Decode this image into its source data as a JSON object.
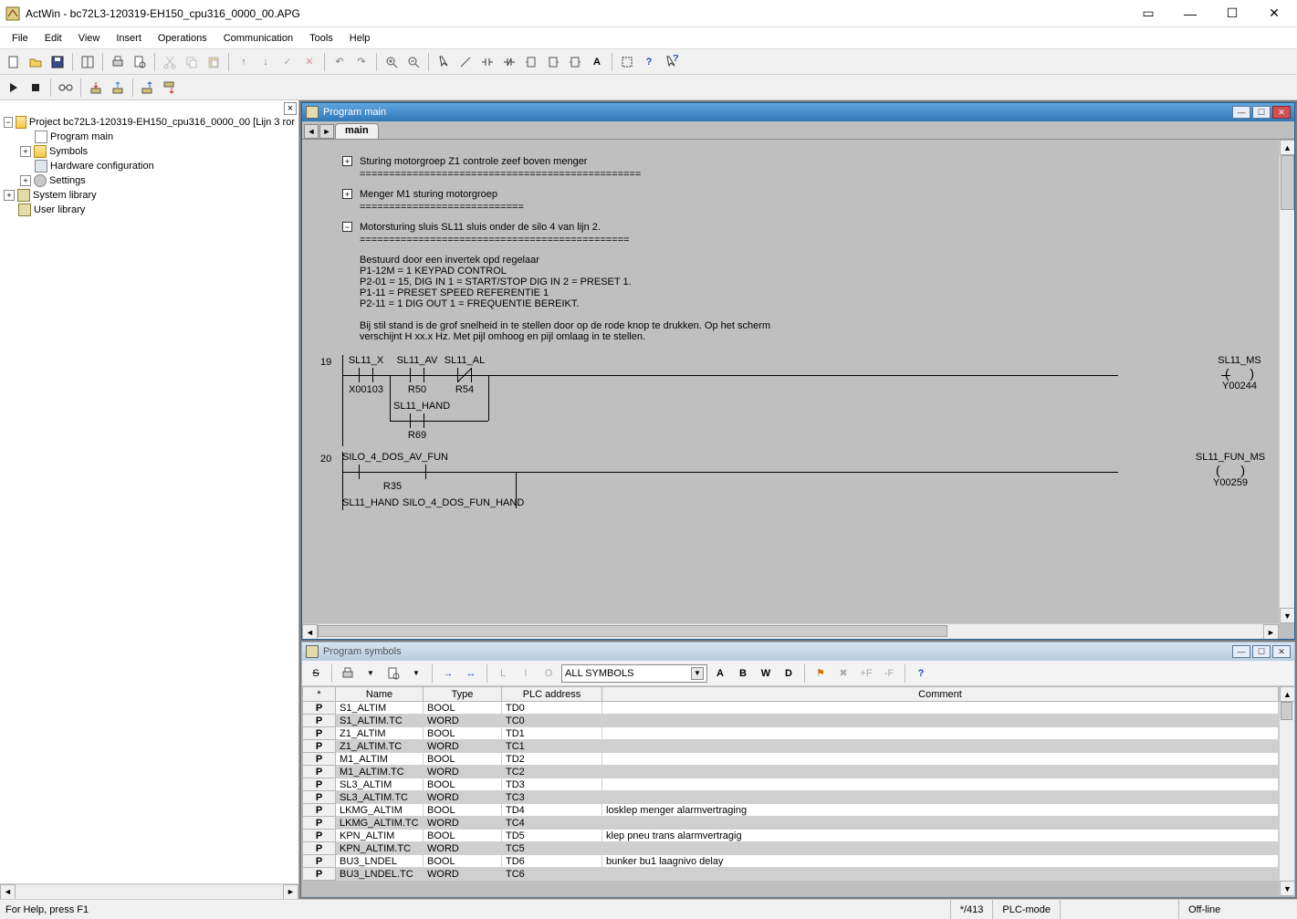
{
  "app_icon": "ActWin",
  "title": "ActWin - bc72L3-120319-EH150_cpu316_0000_00.APG",
  "window_buttons": {
    "extra": "▭",
    "min": "—",
    "max": "☐",
    "close": "✕"
  },
  "menus": [
    "File",
    "Edit",
    "View",
    "Insert",
    "Operations",
    "Communication",
    "Tools",
    "Help"
  ],
  "tree": {
    "project": "Project bc72L3-120319-EH150_cpu316_0000_00 [Lijn 3 ror",
    "program_main": "Program main",
    "symbols": "Symbols",
    "hw_config": "Hardware configuration",
    "settings": "Settings",
    "sys_lib": "System library",
    "user_lib": "User library"
  },
  "program_win": {
    "title": "Program main",
    "tab": "main",
    "rung1_title": "Sturing motorgroep Z1 controle zeef boven menger",
    "rung1_eq": "================================================",
    "rung2_title": "Menger M1 sturing motorgroep",
    "rung2_eq": "============================",
    "rung3_title": "Motorsturing sluis SL11 sluis onder de silo 4 van lijn 2.",
    "rung3_eq": "==============================================",
    "rung3_l1": "Bestuurd door een invertek opd regelaar",
    "rung3_l2": "P1-12M = 1 KEYPAD CONTROL",
    "rung3_l3": "P2-01 = 15, DIG IN 1 = START/STOP DIG IN 2 = PRESET 1.",
    "rung3_l4": "P1-11 = PRESET SPEED REFERENTIE 1",
    "rung3_l5": "P2-11 = 1 DIG OUT 1 = FREQUENTIE BEREIKT.",
    "rung3_l6": "Bij stil stand is de grof snelheid in te stellen door op de rode knop te drukken. Op het scherm",
    "rung3_l7": "verschijnt H xx.x Hz. Met pijl omhoog en pijl omlaag in te stellen.",
    "rung19_num": "19",
    "c_sl11_x": "SL11_X",
    "a_sl11_x": "X00103",
    "c_sl11_av": "SL11_AV",
    "a_sl11_av": "R50",
    "c_sl11_al": "SL11_AL",
    "a_sl11_al": "R54",
    "c_sl11_hand": "SL11_HAND",
    "a_sl11_hand": "R69",
    "coil_sl11_ms": "SL11_MS",
    "a_sl11_ms": "Y00244",
    "rung20_num": "20",
    "c_silo4": "SILO_4_DOS_AV_FUN",
    "a_silo4": "R35",
    "coil_sl11_fun": "SL11_FUN_MS",
    "a_sl11_fun": "Y00259",
    "c_sl11_hand2": "SL11_HAND",
    "c_silo4_fun_hand": "SILO_4_DOS_FUN_HAND"
  },
  "symbols_win": {
    "title": "Program symbols",
    "filter": "ALL SYMBOLS",
    "columns": {
      "star": "*",
      "name": "Name",
      "type": "Type",
      "addr": "PLC address",
      "comment": "Comment"
    },
    "rows": [
      {
        "p": "P",
        "name": "S1_ALTIM",
        "type": "BOOL",
        "addr": "TD0",
        "comment": ""
      },
      {
        "p": "P",
        "name": "S1_ALTIM.TC",
        "type": "WORD",
        "addr": "TC0",
        "comment": ""
      },
      {
        "p": "P",
        "name": "Z1_ALTIM",
        "type": "BOOL",
        "addr": "TD1",
        "comment": ""
      },
      {
        "p": "P",
        "name": "Z1_ALTIM.TC",
        "type": "WORD",
        "addr": "TC1",
        "comment": ""
      },
      {
        "p": "P",
        "name": "M1_ALTIM",
        "type": "BOOL",
        "addr": "TD2",
        "comment": ""
      },
      {
        "p": "P",
        "name": "M1_ALTIM.TC",
        "type": "WORD",
        "addr": "TC2",
        "comment": ""
      },
      {
        "p": "P",
        "name": "SL3_ALTIM",
        "type": "BOOL",
        "addr": "TD3",
        "comment": ""
      },
      {
        "p": "P",
        "name": "SL3_ALTIM.TC",
        "type": "WORD",
        "addr": "TC3",
        "comment": ""
      },
      {
        "p": "P",
        "name": "LKMG_ALTIM",
        "type": "BOOL",
        "addr": "TD4",
        "comment": "losklep menger alarmvertraging"
      },
      {
        "p": "P",
        "name": "LKMG_ALTIM.TC",
        "type": "WORD",
        "addr": "TC4",
        "comment": ""
      },
      {
        "p": "P",
        "name": "KPN_ALTIM",
        "type": "BOOL",
        "addr": "TD5",
        "comment": "klep pneu trans alarmvertragig"
      },
      {
        "p": "P",
        "name": "KPN_ALTIM.TC",
        "type": "WORD",
        "addr": "TC5",
        "comment": ""
      },
      {
        "p": "P",
        "name": "BU3_LNDEL",
        "type": "BOOL",
        "addr": "TD6",
        "comment": "bunker bu1 laagnivo delay"
      },
      {
        "p": "P",
        "name": "BU3_LNDEL.TC",
        "type": "WORD",
        "addr": "TC6",
        "comment": ""
      }
    ],
    "type_buttons": [
      "A",
      "B",
      "W",
      "D"
    ]
  },
  "status": {
    "help": "For Help, press F1",
    "count": "*/413",
    "mode": "PLC-mode",
    "empty": "",
    "online": "Off-line"
  }
}
